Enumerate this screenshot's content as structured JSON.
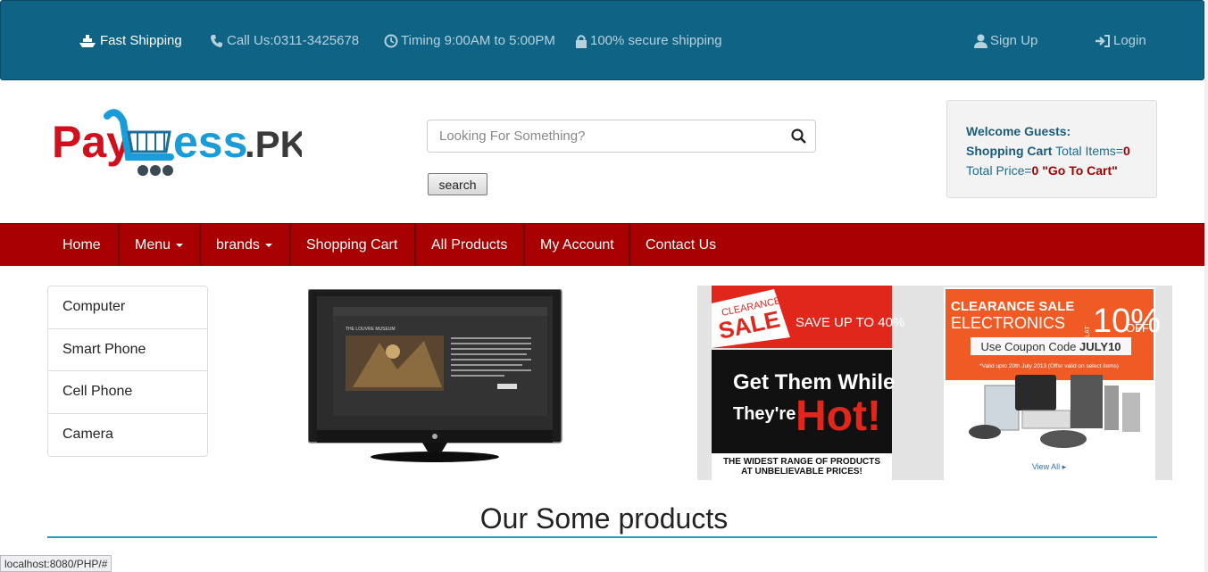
{
  "topbar": {
    "fast_shipping": "Fast Shipping",
    "call_us": "Call Us:0311-3425678",
    "timing": "Timing 9:00AM to 5:00PM",
    "secure": "100% secure shipping",
    "sign_up": "Sign Up",
    "login": "Login"
  },
  "logo": {
    "text_pay": "Pay",
    "text_less": "ess",
    "text_pk": ".PK"
  },
  "search": {
    "placeholder": "Looking For Something?",
    "button_label": "search"
  },
  "welcome": {
    "title": "Welcome Guests:",
    "cart_label": "Shopping Cart",
    "items_label": " Total Items=",
    "items_value": "0",
    "price_label": "Total Price=",
    "price_value": "0",
    "go_to_cart": " \"Go To Cart\""
  },
  "nav": {
    "home": "Home",
    "menu": "Menu",
    "brands": "brands",
    "shopping_cart": "Shopping Cart",
    "all_products": "All Products",
    "my_account": "My Account",
    "contact_us": "Contact Us"
  },
  "categories": [
    "Computer",
    "Smart Phone",
    "Cell Phone",
    "Camera"
  ],
  "tv": {
    "screen_title": "THE LOUVRE MUSEUM"
  },
  "banner_left": {
    "clearance": "CLEARANCE",
    "sale": "SALE",
    "save": "SAVE UP TO 40%",
    "get_them": "Get Them While",
    "theyre": "They're",
    "hot": "Hot!",
    "widest_1": "THE WIDEST RANGE OF PRODUCTS",
    "widest_2": "AT UNBELIEVABLE PRICES!"
  },
  "banner_right": {
    "clearance_sale": "CLEARANCE SALE",
    "electronics": "ELECTRONICS",
    "flat": "FLAT",
    "percent": "10%",
    "off": "OFF",
    "coupon_prefix": "Use Coupon Code ",
    "coupon_code": "JULY10",
    "valid": "*Valid upto 20th July 2013 (Offer valid on select items)",
    "view_all": "View All ▸"
  },
  "section_heading": "Our Some products",
  "status_url": "localhost:8080/PHP/#",
  "colors": {
    "topbar": "#0f6384",
    "navbar": "#a80000",
    "accent_line": "#2a9ac0"
  }
}
